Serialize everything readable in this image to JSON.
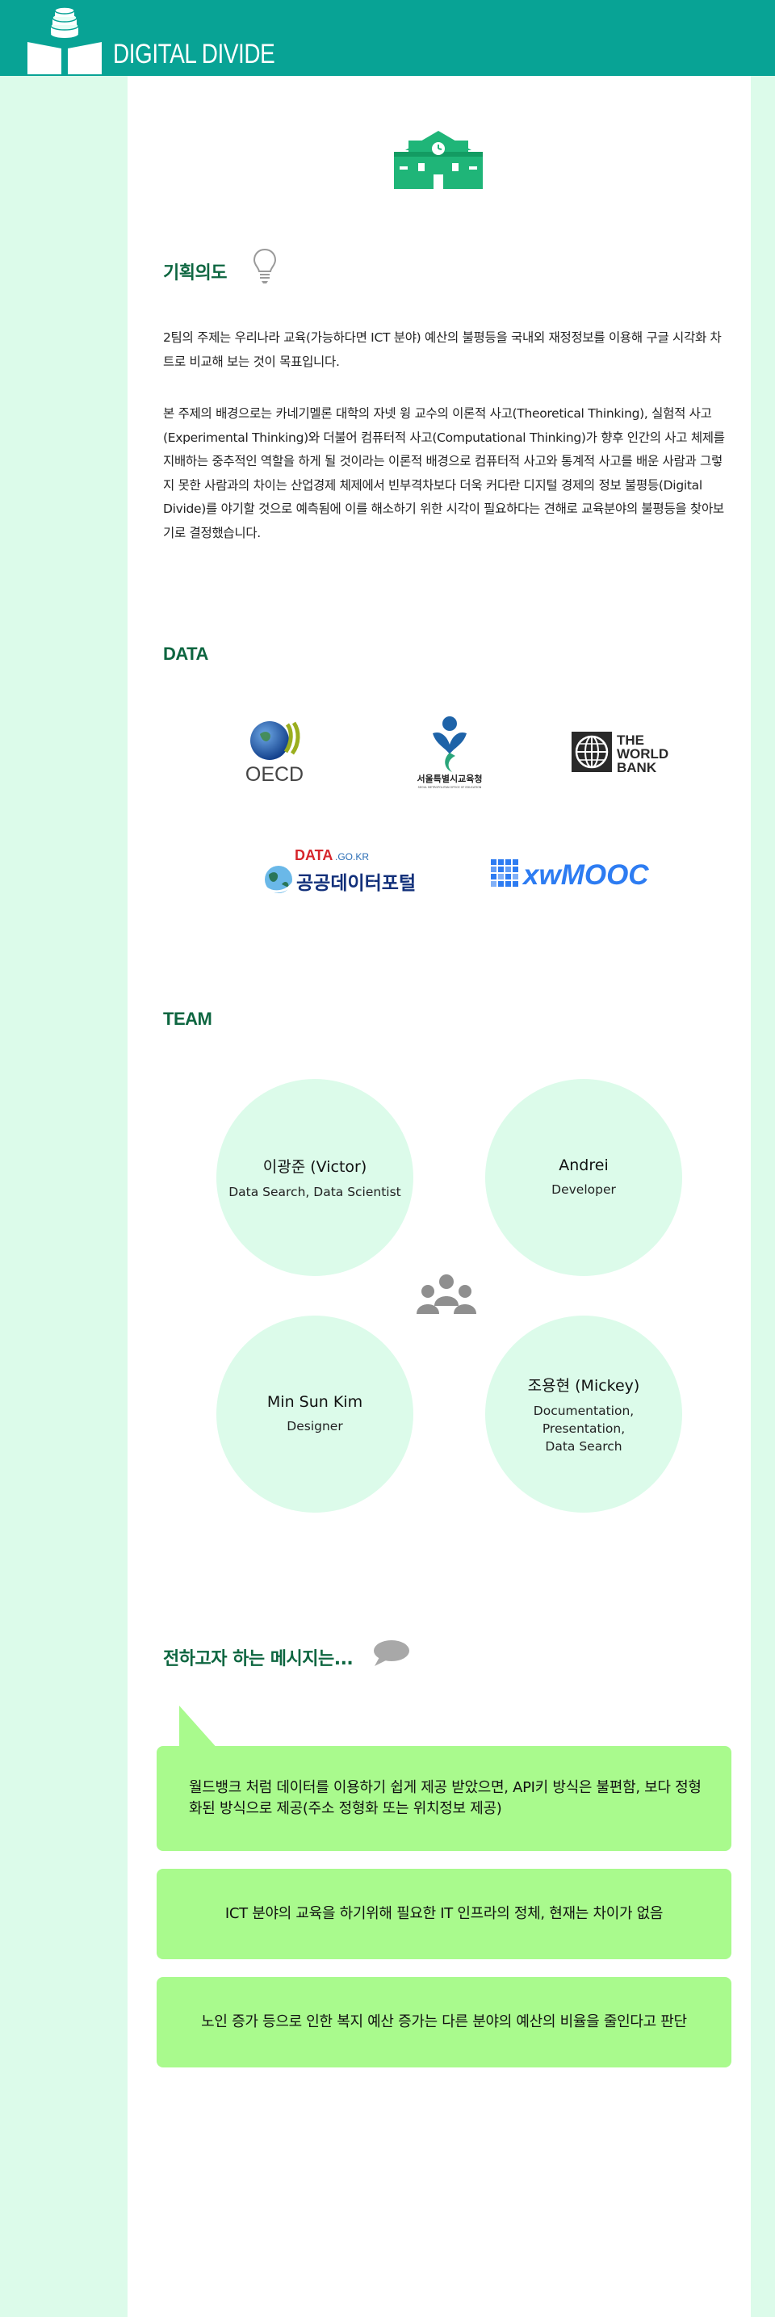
{
  "brand": {
    "title": "DIGITAL DIVIDE"
  },
  "plan": {
    "title": "기획의도",
    "paragraph1": "2팀의 주제는 우리나라 교육(가능하다면 ICT 분야) 예산의 불평등을 국내외 재정정보를 이용해 구글 시각화 차트로 비교해 보는 것이 목표입니다.",
    "paragraph2": "본 주제의 배경으로는 카네기멜론 대학의 자넷 윙 교수의 이론적 사고(Theoretical Thinking), 실험적 사고(Experimental Thinking)와 더불어 컴퓨터적 사고(Computational Thinking)가 향후 인간의 사고 체제를 지배하는 중추적인 역할을 하게 될 것이라는 이론적 배경으로 컴퓨터적 사고와 통계적 사고를 배운 사람과 그렇지 못한 사람과의 차이는 산업경제 체제에서 빈부격차보다 더욱 커다란 디지털 경제의 정보 불평등(Digital Divide)를 야기할 것으로 예측됨에 이를 해소하기 위한 시각이 필요하다는 견해로 교육분야의 불평등을 찾아보기로 결정했습니다."
  },
  "data": {
    "title": "DATA",
    "logos": {
      "oecd": "OECD",
      "seoul": "서울특별시교육청",
      "seoul_en": "SEOUL METROPOLITAN OFFICE OF EDUCATION",
      "worldbank": [
        "THE",
        "WORLD",
        "BANK"
      ],
      "datago_top": "DATA",
      "datago_suffix": ".GO.KR",
      "datago_name": "공공데이터포털",
      "xwmooc": "xwMOOC"
    }
  },
  "team": {
    "title": "TEAM",
    "members": [
      {
        "name": "이광준 (Victor)",
        "role": "Data Search, Data Scientist"
      },
      {
        "name": "Andrei",
        "role": "Developer"
      },
      {
        "name": "Min Sun Kim",
        "role": "Designer"
      },
      {
        "name": "조용현 (Mickey)",
        "role": "Documentation,\nPresentation,\nData Search"
      }
    ]
  },
  "messages": {
    "title": "전하고자 하는 메시지는...",
    "items": [
      "월드뱅크 처럼 데이터를 이용하기 쉽게 제공 받았으면, API키 방식은 불편함, 보다 정형화된 방식으로 제공(주소 정형화 또는 위치정보 제공)",
      "ICT 분야의 교육을 하기위해 필요한 IT 인프라의 정체, 현재는 차이가 없음",
      "노인 증가 등으로 인한 복지 예산 증가는 다른 분야의 예산의 비율을 줄인다고 판단"
    ]
  },
  "colors": {
    "header": "#08a395",
    "title_green": "#0d6640",
    "side_mint": "#dcfbea",
    "bubble_green": "#a9fa8d",
    "icon_green": "#1fb578"
  }
}
